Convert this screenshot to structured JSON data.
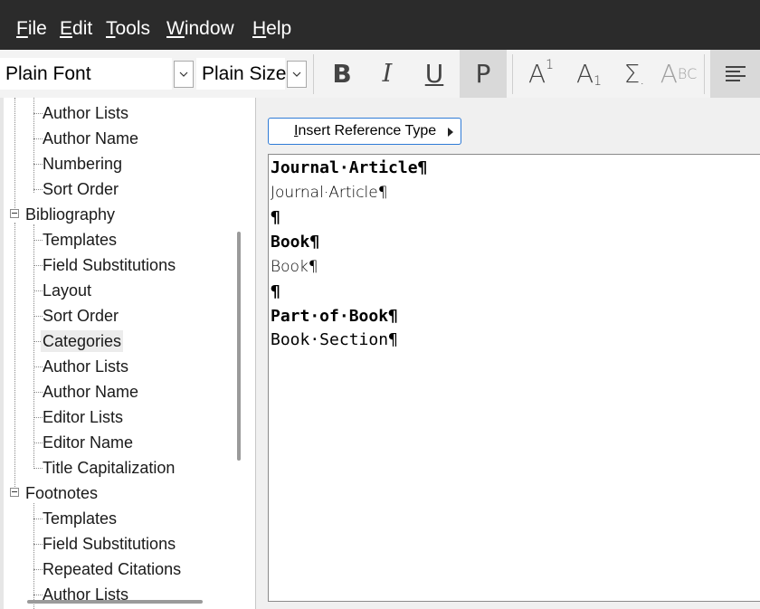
{
  "menu": {
    "file": {
      "accel": "F",
      "rest": "ile"
    },
    "edit": {
      "accel": "E",
      "rest": "dit"
    },
    "tools": {
      "accel": "T",
      "rest": "ools"
    },
    "window": {
      "accel": "W",
      "rest": "indow"
    },
    "help": {
      "accel": "H",
      "rest": "elp"
    }
  },
  "toolbar": {
    "font_value": "Plain Font",
    "size_value": "Plain Size",
    "bold_label": "B",
    "italic_label": "I",
    "underline_label": "U",
    "plain_label": "P",
    "superscript_label": "A",
    "superscript_mark": "1",
    "subscript_label": "A",
    "subscript_mark": "1",
    "symbol_label": "Σ",
    "symbol_mark": ".",
    "smallcaps_label": "A",
    "smallcaps_mark": "BC"
  },
  "tree": {
    "items": [
      {
        "label": "Author Lists",
        "level": 2
      },
      {
        "label": "Author Name",
        "level": 2
      },
      {
        "label": "Numbering",
        "level": 2
      },
      {
        "label": "Sort Order",
        "level": 2
      },
      {
        "label": "Bibliography",
        "level": 1
      },
      {
        "label": "Templates",
        "level": 2
      },
      {
        "label": "Field Substitutions",
        "level": 2
      },
      {
        "label": "Layout",
        "level": 2
      },
      {
        "label": "Sort Order",
        "level": 2
      },
      {
        "label": "Categories",
        "level": 2,
        "selected": true
      },
      {
        "label": "Author Lists",
        "level": 2
      },
      {
        "label": "Author Name",
        "level": 2
      },
      {
        "label": "Editor Lists",
        "level": 2
      },
      {
        "label": "Editor Name",
        "level": 2
      },
      {
        "label": "Title Capitalization",
        "level": 2
      },
      {
        "label": "Footnotes",
        "level": 1
      },
      {
        "label": "Templates",
        "level": 2
      },
      {
        "label": "Field Substitutions",
        "level": 2
      },
      {
        "label": "Repeated Citations",
        "level": 2
      },
      {
        "label": "Author Lists",
        "level": 2
      }
    ]
  },
  "editor": {
    "insert_button": {
      "accel": "I",
      "rest": "nsert Reference Type"
    },
    "lines": [
      {
        "text": "Journal·Article¶",
        "style": "mono-bold"
      },
      {
        "text": "Journal·Article¶",
        "style": "plain"
      },
      {
        "text": "¶",
        "style": "mono-bold"
      },
      {
        "text": "Book¶",
        "style": "mono-bold"
      },
      {
        "text": "Book¶",
        "style": "plain"
      },
      {
        "text": "¶",
        "style": "mono-bold"
      },
      {
        "text": "Part·of·Book¶",
        "style": "mono-bold"
      },
      {
        "text": "Book·Section¶",
        "style": "mono"
      }
    ]
  }
}
